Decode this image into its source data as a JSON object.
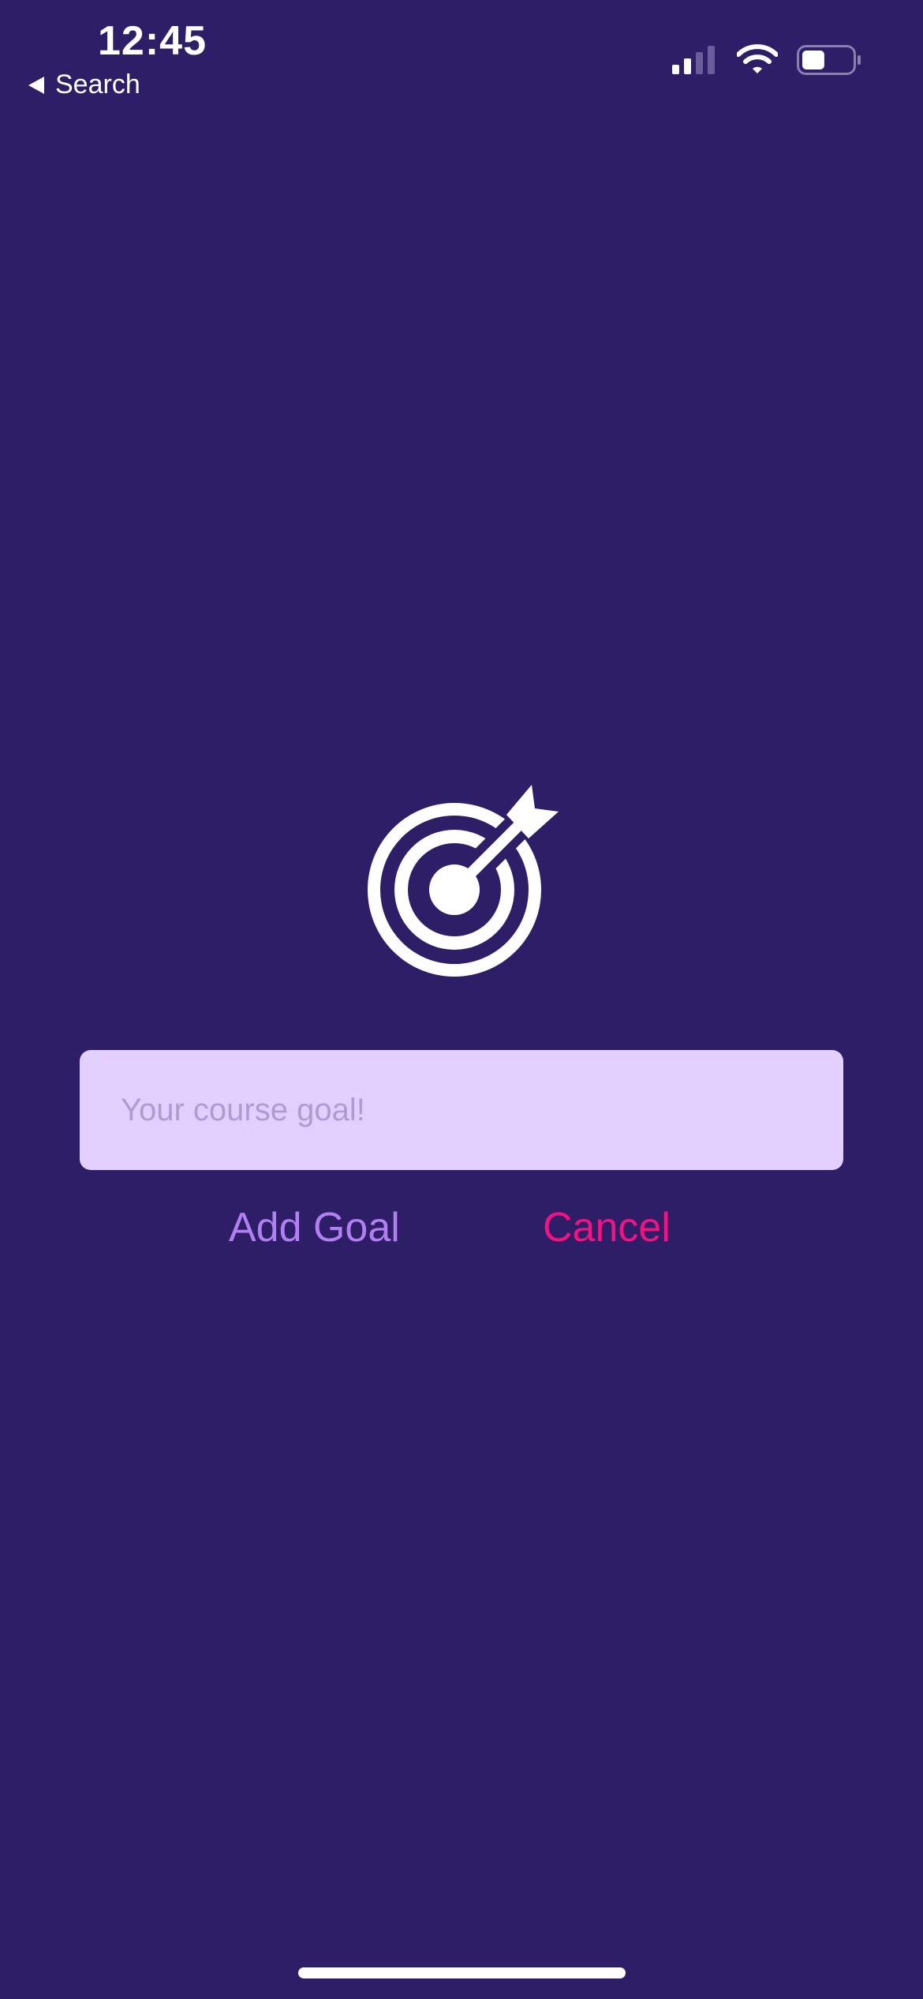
{
  "status_bar": {
    "time": "12:45",
    "back_label": "Search",
    "signal_icon": "cellular-signal-icon",
    "wifi_icon": "wifi-icon",
    "battery_icon": "battery-icon",
    "battery_level": 0.45
  },
  "goal_image": {
    "icon": "target-dart-icon"
  },
  "goal_input": {
    "value": "",
    "placeholder": "Your course goal!"
  },
  "actions": {
    "add_label": "Add Goal",
    "cancel_label": "Cancel"
  },
  "colors": {
    "background": "#2e1d67",
    "input_background": "#e4d0ff",
    "add_button": "#b180f0",
    "cancel_button": "#f31282"
  }
}
